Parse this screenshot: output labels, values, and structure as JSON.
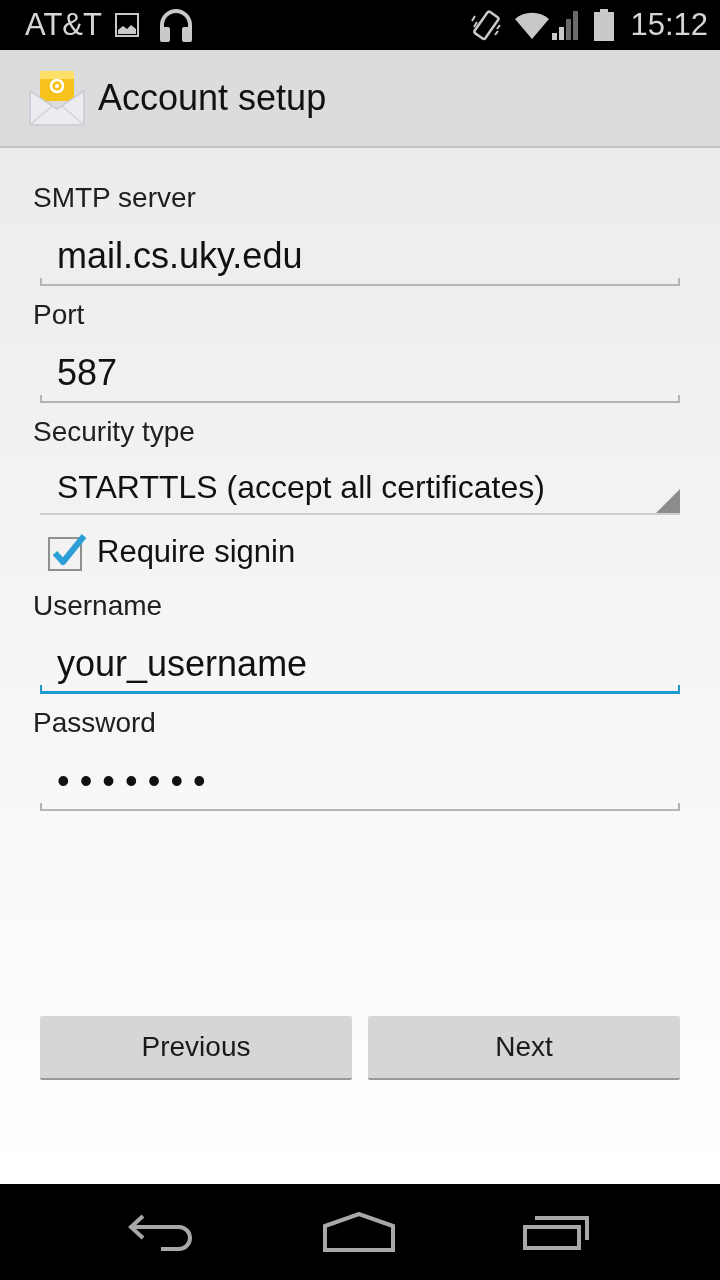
{
  "status_bar": {
    "carrier": "AT&T",
    "time": "15:12"
  },
  "action_bar": {
    "title": "Account setup"
  },
  "form": [
    {
      "kind": "text",
      "label": "SMTP server",
      "value": "mail.cs.uky.edu",
      "focused": false
    },
    {
      "kind": "text",
      "label": "Port",
      "value": "587",
      "focused": false
    },
    {
      "kind": "spinner",
      "label": "Security type",
      "value": "STARTTLS (accept all certificates)"
    },
    {
      "kind": "checkbox",
      "label": "Require signin",
      "checked": true
    },
    {
      "kind": "text",
      "label": "Username",
      "value": "your_username",
      "focused": true
    },
    {
      "kind": "password",
      "label": "Password",
      "value": "•••••••",
      "focused": false
    }
  ],
  "buttons": [
    {
      "label": "Previous"
    },
    {
      "label": "Next"
    }
  ]
}
